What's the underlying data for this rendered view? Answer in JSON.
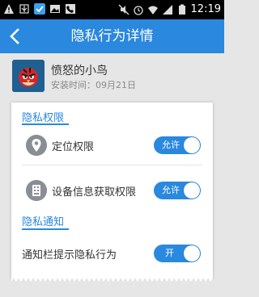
{
  "status_bar": {
    "time": "12:19",
    "left_icons": [
      "warning-icon",
      "usb-icon",
      "notification-check-icon",
      "gallery-icon",
      "phone-icon"
    ],
    "right_icons": [
      "mute-icon",
      "alarm-icon",
      "wifi-icon",
      "signal-icon",
      "battery-icon"
    ]
  },
  "header": {
    "title": "隐私行为详情",
    "background": "#2a88de"
  },
  "app": {
    "name": "愤怒的小鸟",
    "install_time": "安装时间：09月21日"
  },
  "sections": [
    {
      "title": "隐私权限",
      "items": [
        {
          "label": "定位权限",
          "icon": "location-pin-icon",
          "toggle_label": "允许"
        },
        {
          "label": "设备信息获取权限",
          "icon": "device-info-icon",
          "toggle_label": "允许"
        }
      ]
    },
    {
      "title": "隐私通知",
      "items": [
        {
          "label": "通知栏提示隐私行为",
          "toggle_label": "开"
        }
      ]
    }
  ]
}
